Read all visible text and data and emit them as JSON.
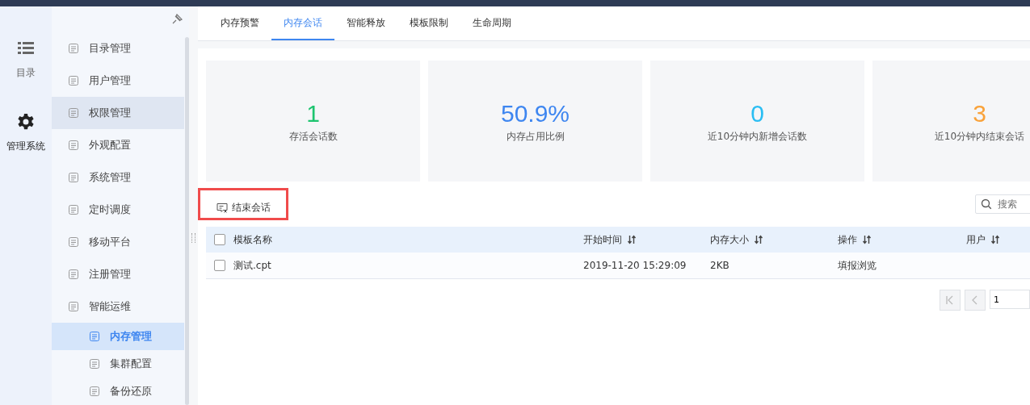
{
  "rail": [
    {
      "label": "目录",
      "selected": false
    },
    {
      "label": "管理系统",
      "selected": true
    }
  ],
  "sidebar": {
    "items": [
      {
        "label": "目录管理",
        "selected": false,
        "hovered": false
      },
      {
        "label": "用户管理",
        "selected": false,
        "hovered": false
      },
      {
        "label": "权限管理",
        "selected": false,
        "hovered": true
      },
      {
        "label": "外观配置",
        "selected": false,
        "hovered": false
      },
      {
        "label": "系统管理",
        "selected": false,
        "hovered": false
      },
      {
        "label": "定时调度",
        "selected": false,
        "hovered": false
      },
      {
        "label": "移动平台",
        "selected": false,
        "hovered": false
      },
      {
        "label": "注册管理",
        "selected": false,
        "hovered": false
      },
      {
        "label": "智能运维",
        "selected": false,
        "hovered": false,
        "children": [
          {
            "label": "内存管理",
            "selected": true,
            "hovered": false
          },
          {
            "label": "集群配置",
            "selected": false,
            "hovered": false
          },
          {
            "label": "备份还原",
            "selected": false,
            "hovered": false
          }
        ]
      }
    ]
  },
  "tabs": [
    {
      "label": "内存预警",
      "selected": false
    },
    {
      "label": "内存会话",
      "selected": true
    },
    {
      "label": "智能释放",
      "selected": false
    },
    {
      "label": "模板限制",
      "selected": false
    },
    {
      "label": "生命周期",
      "selected": false
    }
  ],
  "stats": [
    {
      "value": "1",
      "label": "存活会话数",
      "color": "#1dc46f"
    },
    {
      "value": "50.9%",
      "label": "内存占用比例",
      "color": "#3e86f0"
    },
    {
      "value": "0",
      "label": "近10分钟内新增会话数",
      "color": "#29bdf3"
    },
    {
      "value": "3",
      "label": "近10分钟内结束会话",
      "color": "#f9a23a"
    }
  ],
  "toolbar": {
    "end_session_button": "结束会话",
    "highlighted": true,
    "search": {
      "placeholder": "搜索"
    }
  },
  "table": {
    "columns": [
      {
        "label": "模板名称",
        "sortable": false
      },
      {
        "label": "开始时间",
        "sortable": true
      },
      {
        "label": "内存大小",
        "sortable": true
      },
      {
        "label": "操作",
        "sortable": true
      },
      {
        "label": "用户",
        "sortable": true
      }
    ],
    "header_checked": false,
    "rows": [
      {
        "checked": false,
        "cells": [
          "测试.cpt",
          "2019-11-20 15:29:09",
          "2KB",
          "填报浏览",
          ""
        ]
      }
    ]
  },
  "pagination": {
    "page": "1"
  }
}
